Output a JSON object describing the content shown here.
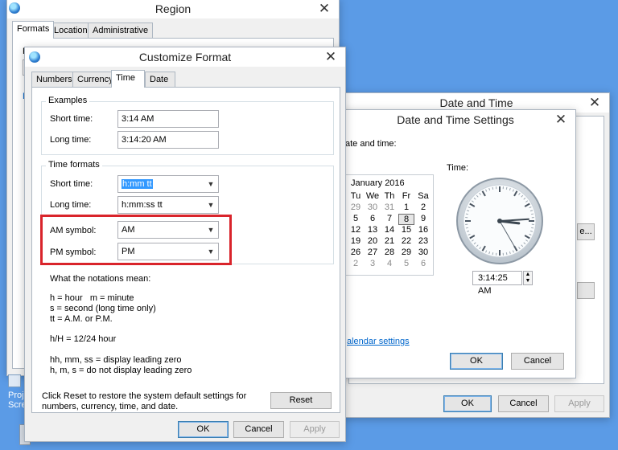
{
  "region": {
    "title": "Region",
    "tabs": [
      "Formats",
      "Location",
      "Administrative"
    ],
    "fragment_left": "F",
    "fragment_link": "L",
    "desktop_icon_label_1": "Proj",
    "desktop_icon_label_2": "Scre"
  },
  "datetime": {
    "title": "Date and Time",
    "buttons": {
      "ok": "OK",
      "cancel": "Cancel",
      "apply": "Apply"
    },
    "fragment_btn": "e..."
  },
  "dts": {
    "title": "Date and Time Settings",
    "date_label_partial": "ate and time:",
    "time_label": "Time:",
    "calendar": {
      "month": "January 2016",
      "headers": [
        "Tu",
        "We",
        "Th",
        "Fr",
        "Sa"
      ],
      "rows": [
        [
          "29",
          "30",
          "31",
          "1",
          "2"
        ],
        [
          "5",
          "6",
          "7",
          "8",
          "9"
        ],
        [
          "12",
          "13",
          "14",
          "15",
          "16"
        ],
        [
          "19",
          "20",
          "21",
          "22",
          "23"
        ],
        [
          "26",
          "27",
          "28",
          "29",
          "30"
        ],
        [
          "2",
          "3",
          "4",
          "5",
          "6"
        ]
      ]
    },
    "time_value": "3:14:25 AM",
    "link": "alendar settings",
    "buttons": {
      "ok": "OK",
      "cancel": "Cancel"
    }
  },
  "customize": {
    "title": "Customize Format",
    "tabs": [
      "Numbers",
      "Currency",
      "Time",
      "Date"
    ],
    "examples": {
      "legend": "Examples",
      "short_label": "Short time:",
      "short_value": "3:14 AM",
      "long_label": "Long time:",
      "long_value": "3:14:20 AM"
    },
    "formats": {
      "legend": "Time formats",
      "short_label": "Short time:",
      "short_value": "h:mm tt",
      "long_label": "Long time:",
      "long_value": "h:mm:ss tt",
      "am_label": "AM symbol:",
      "am_value": "AM",
      "pm_label": "PM symbol:",
      "pm_value": "PM"
    },
    "notations": {
      "heading": "What the notations mean:",
      "line1": "h = hour   m = minute",
      "line2": "s = second (long time only)",
      "line3": "tt = A.M. or P.M.",
      "line4": "h/H = 12/24 hour",
      "line5": "hh, mm, ss = display leading zero",
      "line6": "h, m, s = do not display leading zero"
    },
    "reset_text_1": "Click Reset to restore the system default settings for",
    "reset_text_2": "numbers, currency, time, and date.",
    "buttons": {
      "reset": "Reset",
      "ok": "OK",
      "cancel": "Cancel",
      "apply": "Apply"
    }
  },
  "colors": {
    "desktop": "#5b9be6",
    "highlight_box": "#d9242b",
    "selection": "#3399ff"
  },
  "clock": {
    "hour": 3,
    "minute": 14,
    "second": 25
  }
}
